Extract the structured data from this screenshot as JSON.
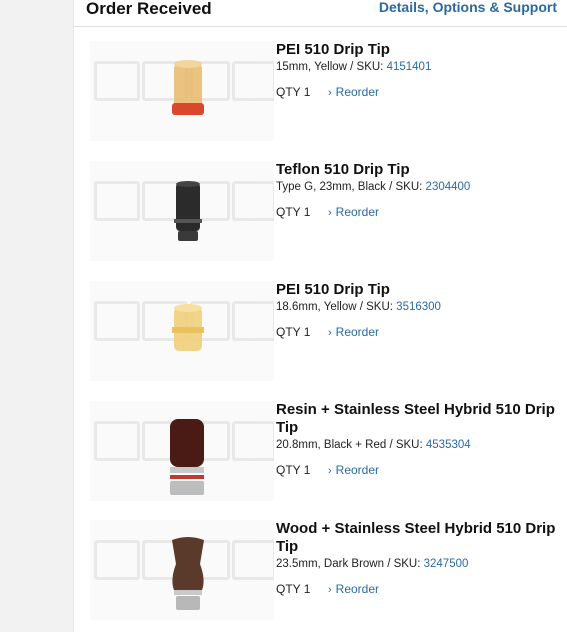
{
  "header": {
    "title": "Order Received",
    "link": "Details, Options & Support"
  },
  "items": [
    {
      "name": "PEI 510 Drip Tip",
      "spec": "15mm, Yellow / SKU: ",
      "sku": "4151401",
      "qty": "QTY 1",
      "reorder": "Reorder",
      "colors": {
        "body": "#e8b86a",
        "band": "#d9482b",
        "base": "#e07a4a"
      }
    },
    {
      "name": "Teflon 510 Drip Tip",
      "spec": "Type G, 23mm, Black / SKU: ",
      "sku": "2304400",
      "qty": "QTY 1",
      "reorder": "Reorder",
      "colors": {
        "body": "#2b2b2b",
        "band": "#555555",
        "base": "#3a3a3a"
      }
    },
    {
      "name": "PEI 510 Drip Tip",
      "spec": "18.6mm, Yellow / SKU: ",
      "sku": "3516300",
      "qty": "QTY 1",
      "reorder": "Reorder",
      "colors": {
        "body": "#f0cf7a",
        "band": "#e9c160",
        "base": "#f2d68a"
      }
    },
    {
      "name": "Resin + Stainless Steel Hybrid 510 Drip Tip",
      "spec": "20.8mm, Black + Red / SKU: ",
      "sku": "4535304",
      "qty": "QTY 1",
      "reorder": "Reorder",
      "colors": {
        "body": "#4a1a14",
        "band": "#c9c9c9",
        "base": "#bdbdbd"
      }
    },
    {
      "name": "Wood + Stainless Steel Hybrid 510 Drip Tip",
      "spec": "23.5mm, Dark Brown / SKU: ",
      "sku": "3247500",
      "qty": "QTY 1",
      "reorder": "Reorder",
      "colors": {
        "body": "#5a3a2a",
        "band": "#c9c9c9",
        "base": "#b8b8b8"
      }
    }
  ]
}
